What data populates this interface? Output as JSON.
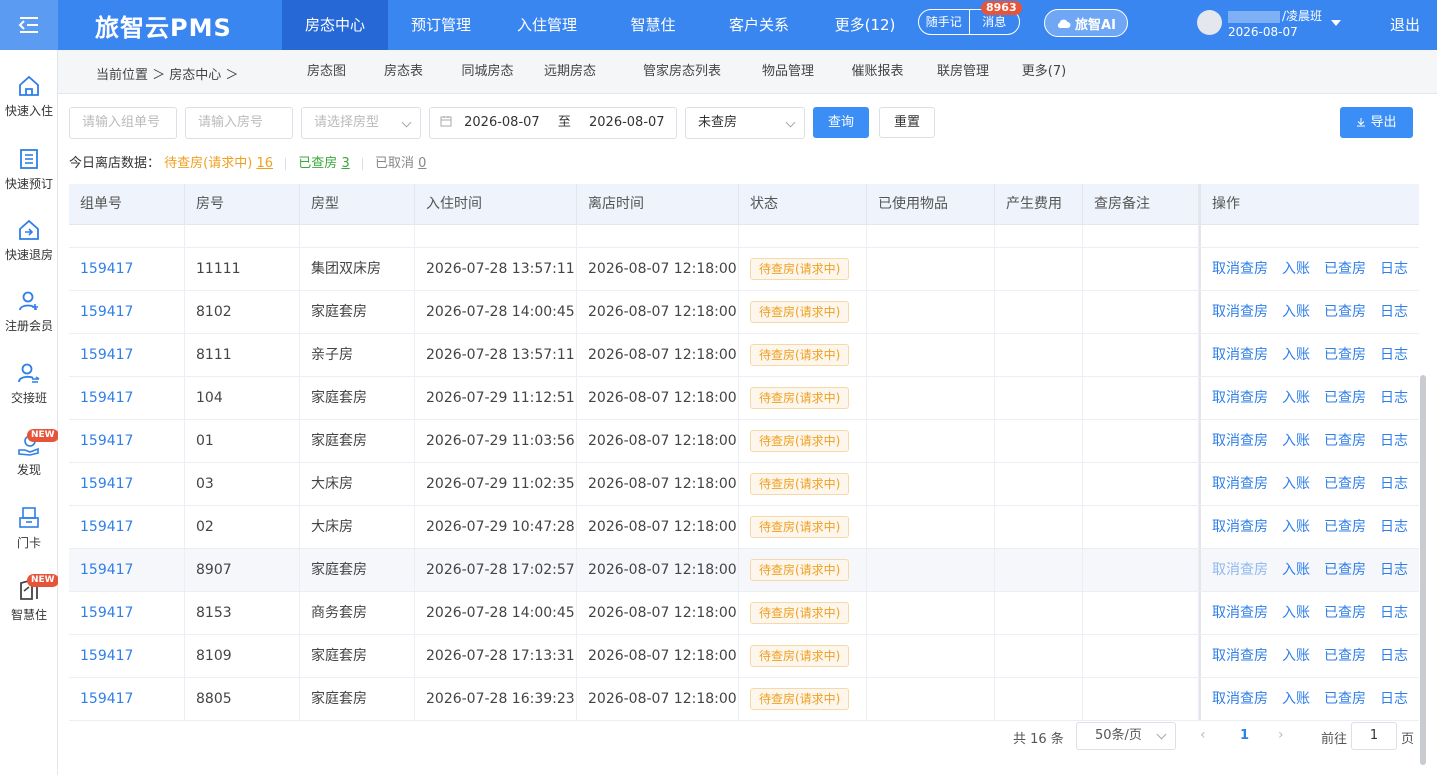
{
  "topbar": {
    "logo": "旅智云PMS",
    "nav": [
      "房态中心",
      "预订管理",
      "入住管理",
      "智慧住",
      "客户关系",
      "更多(12)"
    ],
    "notes_label": "随手记",
    "message_label": "消息",
    "message_count": "8963",
    "ai_label": "旅智AI",
    "user_name": "/凌晨班",
    "user_date": "2026-08-07",
    "logout": "退出"
  },
  "sidebar": {
    "items": [
      "快速入住",
      "快速预订",
      "快速退房",
      "注册会员",
      "交接班",
      "发现",
      "门卡",
      "智慧住"
    ],
    "new_badge": "NEW"
  },
  "subnav": {
    "breadcrumb": "当前位置 ＞ 房态中心 ＞",
    "links": [
      "房态图",
      "房态表",
      "同城房态",
      "远期房态",
      "管家房态列表",
      "物品管理",
      "催账报表",
      "联房管理",
      "更多(7)"
    ]
  },
  "filters": {
    "order_placeholder": "请输入组单号",
    "room_placeholder": "请输入房号",
    "roomtype_placeholder": "请选择房型",
    "date_from": "2026-08-07",
    "date_to_label": "至",
    "date_to": "2026-08-07",
    "status_value": "未查房",
    "query_button": "查询",
    "reset_button": "重置",
    "export_button": "导出"
  },
  "stats": {
    "label": "今日离店数据：",
    "pending_label": "待查房(请求中)",
    "pending_count": "16",
    "checked_label": "已查房",
    "checked_count": "3",
    "cancelled_label": "已取消",
    "cancelled_count": "0"
  },
  "table": {
    "headers": [
      "组单号",
      "房号",
      "房型",
      "入住时间",
      "离店时间",
      "状态",
      "已使用物品",
      "产生费用",
      "查房备注",
      "操作"
    ],
    "actions": [
      "取消查房",
      "入账",
      "已查房",
      "日志"
    ],
    "rows": [
      {
        "order": "159417",
        "room": "11111",
        "type": "集团双床房",
        "checkin": "2026-07-28 13:57:11",
        "checkout": "2026-08-07 12:18:00",
        "status": "待查房(请求中)"
      },
      {
        "order": "159417",
        "room": "8102",
        "type": "家庭套房",
        "checkin": "2026-07-28 14:00:45",
        "checkout": "2026-08-07 12:18:00",
        "status": "待查房(请求中)"
      },
      {
        "order": "159417",
        "room": "8111",
        "type": "亲子房",
        "checkin": "2026-07-28 13:57:11",
        "checkout": "2026-08-07 12:18:00",
        "status": "待查房(请求中)"
      },
      {
        "order": "159417",
        "room": "104",
        "type": "家庭套房",
        "checkin": "2026-07-29 11:12:51",
        "checkout": "2026-08-07 12:18:00",
        "status": "待查房(请求中)"
      },
      {
        "order": "159417",
        "room": "01",
        "type": "家庭套房",
        "checkin": "2026-07-29 11:03:56",
        "checkout": "2026-08-07 12:18:00",
        "status": "待查房(请求中)"
      },
      {
        "order": "159417",
        "room": "03",
        "type": "大床房",
        "checkin": "2026-07-29 11:02:35",
        "checkout": "2026-08-07 12:18:00",
        "status": "待查房(请求中)"
      },
      {
        "order": "159417",
        "room": "02",
        "type": "大床房",
        "checkin": "2026-07-29 10:47:28",
        "checkout": "2026-08-07 12:18:00",
        "status": "待查房(请求中)"
      },
      {
        "order": "159417",
        "room": "8907",
        "type": "家庭套房",
        "checkin": "2026-07-28 17:02:57",
        "checkout": "2026-08-07 12:18:00",
        "status": "待查房(请求中)"
      },
      {
        "order": "159417",
        "room": "8153",
        "type": "商务套房",
        "checkin": "2026-07-28 14:00:45",
        "checkout": "2026-08-07 12:18:00",
        "status": "待查房(请求中)"
      },
      {
        "order": "159417",
        "room": "8109",
        "type": "家庭套房",
        "checkin": "2026-07-28 17:13:31",
        "checkout": "2026-08-07 12:18:00",
        "status": "待查房(请求中)"
      },
      {
        "order": "159417",
        "room": "8805",
        "type": "家庭套房",
        "checkin": "2026-07-28 16:39:23",
        "checkout": "2026-08-07 12:18:00",
        "status": "待查房(请求中)"
      }
    ]
  },
  "pagination": {
    "total": "共 16 条",
    "page_size": "50条/页",
    "current": "1",
    "goto_label": "前往",
    "goto_value": "1",
    "page_suffix": "页"
  },
  "colors": {
    "primary": "#3a86f0",
    "link": "#2f7fe8",
    "warning": "#f0a020",
    "success": "#3aa83a",
    "badge": "#e6553a"
  }
}
